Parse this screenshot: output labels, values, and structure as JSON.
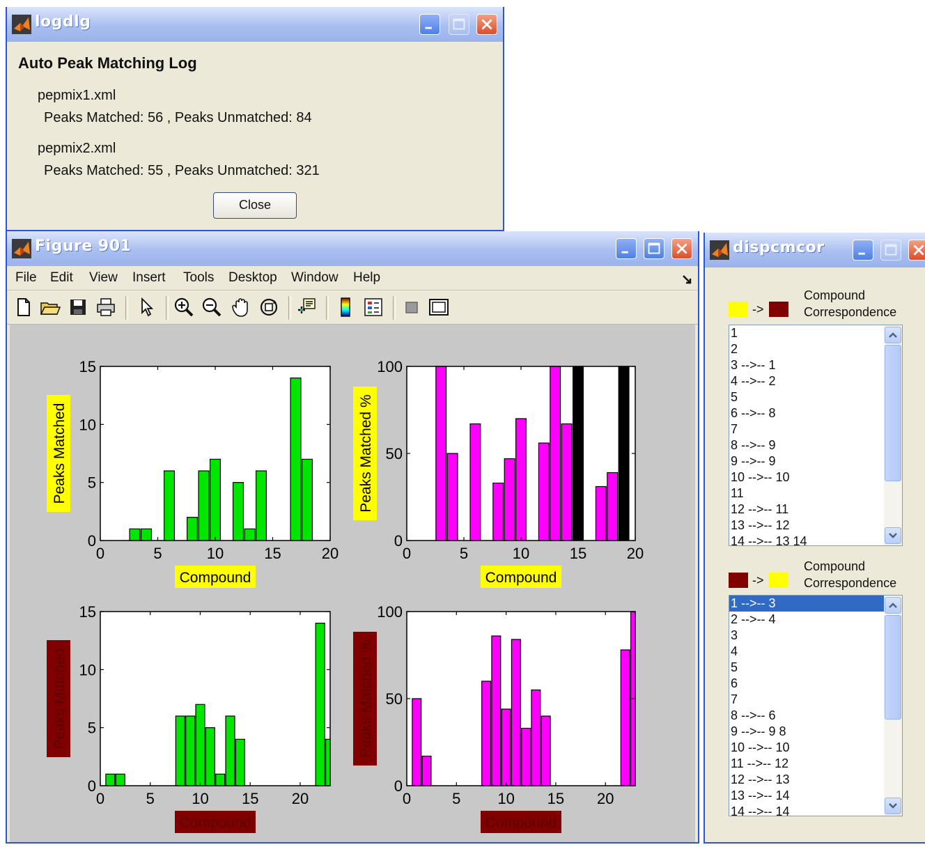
{
  "logdlg": {
    "title": "logdlg",
    "heading": "Auto Peak Matching Log",
    "file1": "pepmix1.xml",
    "result1": "Peaks Matched: 56 , Peaks Unmatched: 84",
    "file2": "pepmix2.xml",
    "result2": "Peaks Matched: 55 , Peaks Unmatched: 321",
    "close_label": "Close"
  },
  "figure": {
    "title": "Figure 901",
    "menu": [
      "File",
      "Edit",
      "View",
      "Insert",
      "Tools",
      "Desktop",
      "Window",
      "Help"
    ],
    "toolbar_icons": [
      "new-file-icon",
      "open-file-icon",
      "save-icon",
      "print-icon",
      "pointer-icon",
      "zoom-in-icon",
      "zoom-out-icon",
      "pan-hand-icon",
      "rotate-3d-icon",
      "data-cursor-icon",
      "colorbar-icon",
      "legend-icon",
      "hide-plot-tools-icon",
      "show-plot-tools-icon"
    ]
  },
  "dispcmcor": {
    "title": "dispcmcor",
    "group1": {
      "label_line1": "Compound",
      "label_line2": "Correspondence",
      "arrow": "->",
      "from_color": "#ffff00",
      "to_color": "#800000",
      "items": [
        "1",
        "2",
        "3 -->-- 1",
        "4 -->-- 2",
        "5",
        "6 -->-- 8",
        "7",
        "8 -->-- 9",
        "9 -->-- 9",
        "10 -->-- 10",
        "11",
        "12 -->-- 11",
        "13 -->-- 12",
        "14 -->-- 13  14"
      ]
    },
    "group2": {
      "label_line1": "Compound",
      "label_line2": "Correspondence",
      "arrow": "->",
      "from_color": "#800000",
      "to_color": "#ffff00",
      "selected_index": 0,
      "items": [
        "1 -->-- 3",
        "2 -->-- 4",
        "3",
        "4",
        "5",
        "6",
        "7",
        "8 -->-- 6",
        "9 -->-- 9  8",
        "10 -->-- 10",
        "11 -->-- 12",
        "12 -->-- 13",
        "13 -->-- 14",
        "14 -->-- 14"
      ]
    }
  },
  "chart_data": [
    {
      "type": "bar",
      "xlabel": "Compound",
      "ylabel": "Peaks Matched",
      "label_bg": "#ffff00",
      "label_fg": "#000000",
      "bar_color": "#00e600",
      "xlim": [
        0,
        20
      ],
      "ylim": [
        0,
        15
      ],
      "xticks": [
        0,
        5,
        10,
        15,
        20
      ],
      "yticks": [
        0,
        5,
        10,
        15
      ],
      "x": [
        3,
        4,
        6,
        8,
        9,
        10,
        12,
        13,
        14,
        17,
        18
      ],
      "values": [
        1,
        1,
        6,
        2,
        6,
        7,
        5,
        1,
        6,
        14,
        7
      ]
    },
    {
      "type": "bar",
      "xlabel": "Compound",
      "ylabel": "Peaks Matched %",
      "label_bg": "#ffff00",
      "label_fg": "#000000",
      "bar_color": "#ff00ff",
      "xlim": [
        0,
        20
      ],
      "ylim": [
        0,
        100
      ],
      "xticks": [
        0,
        5,
        10,
        15,
        20
      ],
      "yticks": [
        0,
        50,
        100
      ],
      "x": [
        3,
        4,
        6,
        8,
        9,
        10,
        12,
        13,
        14,
        15,
        17,
        18,
        19
      ],
      "values": [
        100,
        50,
        67,
        33,
        47,
        70,
        56,
        100,
        67,
        100,
        31,
        39,
        100
      ],
      "colors": [
        "#ff00ff",
        "#ff00ff",
        "#ff00ff",
        "#ff00ff",
        "#ff00ff",
        "#ff00ff",
        "#ff00ff",
        "#ff00ff",
        "#ff00ff",
        "#000000",
        "#ff00ff",
        "#ff00ff",
        "#000000"
      ]
    },
    {
      "type": "bar",
      "xlabel": "Compound",
      "ylabel": "Peaks Matched",
      "label_bg": "#800000",
      "label_fg": "#5a0000",
      "bar_color": "#00e600",
      "xlim": [
        0,
        23
      ],
      "ylim": [
        0,
        15
      ],
      "xticks": [
        0,
        5,
        10,
        15,
        20
      ],
      "yticks": [
        0,
        5,
        10,
        15
      ],
      "x": [
        1,
        2,
        8,
        9,
        10,
        11,
        12,
        13,
        14,
        22,
        23
      ],
      "values": [
        1,
        1,
        6,
        6,
        7,
        5,
        1,
        6,
        4,
        14,
        4
      ]
    },
    {
      "type": "bar",
      "xlabel": "Compound",
      "ylabel": "Peaks Matched %",
      "label_bg": "#800000",
      "label_fg": "#5a0000",
      "bar_color": "#ff00ff",
      "xlim": [
        0,
        23
      ],
      "ylim": [
        0,
        100
      ],
      "xticks": [
        0,
        5,
        10,
        15,
        20
      ],
      "yticks": [
        0,
        50,
        100
      ],
      "x": [
        1,
        2,
        8,
        9,
        10,
        11,
        12,
        13,
        14,
        22,
        23
      ],
      "values": [
        50,
        17,
        60,
        86,
        44,
        84,
        33,
        55,
        40,
        78,
        100
      ]
    }
  ]
}
